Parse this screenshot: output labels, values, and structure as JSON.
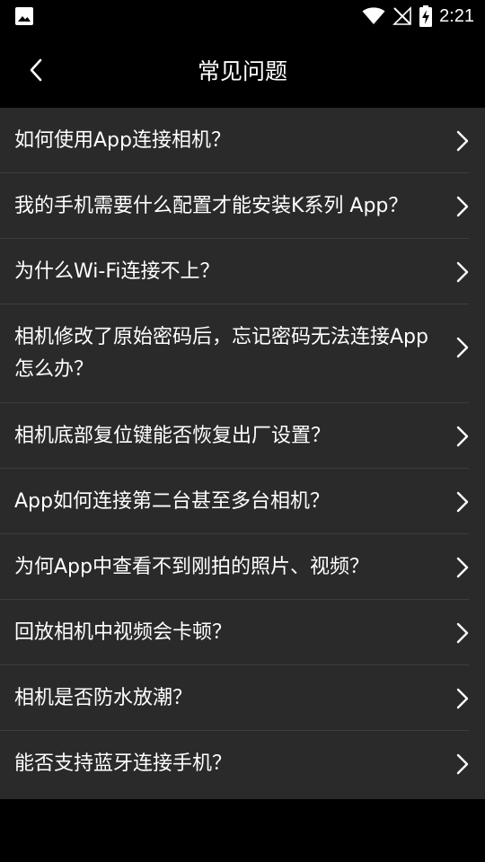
{
  "status_bar": {
    "time": "2:21",
    "icons": [
      "image-icon",
      "wifi-icon",
      "signal-off-icon",
      "battery-charging-icon"
    ]
  },
  "header": {
    "title": "常见问题",
    "back_icon": "back-arrow-icon"
  },
  "faq": {
    "items": [
      {
        "label": "如何使用App连接相机？"
      },
      {
        "label": "我的手机需要什么配置才能安装K系列 App？"
      },
      {
        "label": "为什么Wi-Fi连接不上？"
      },
      {
        "label": "相机修改了原始密码后，忘记密码无法连接App怎么办？"
      },
      {
        "label": "相机底部复位键能否恢复出厂设置？"
      },
      {
        "label": "App如何连接第二台甚至多台相机？"
      },
      {
        "label": "为何App中查看不到刚拍的照片、视频？"
      },
      {
        "label": "回放相机中视频会卡顿？"
      },
      {
        "label": "相机是否防水放潮？"
      },
      {
        "label": "能否支持蓝牙连接手机？"
      }
    ]
  },
  "colors": {
    "background": "#000000",
    "list_background": "#2a2a2a",
    "divider": "#3e3e3e",
    "text": "#ffffff"
  }
}
